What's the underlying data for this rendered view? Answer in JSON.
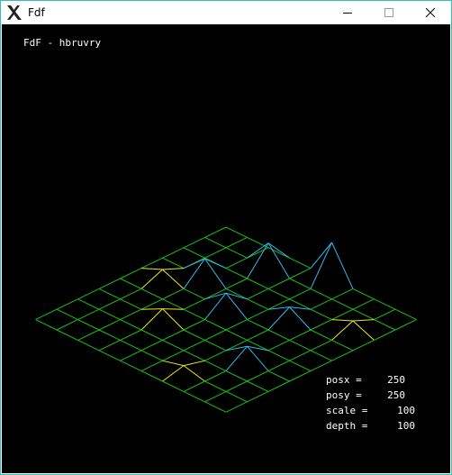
{
  "window": {
    "title": "Fdf",
    "icon": "x-logo-icon",
    "border_color": "#2fc3b0"
  },
  "controls": {
    "minimize_icon": "minimize-icon",
    "maximize_icon": "maximize-icon",
    "close_icon": "close-icon"
  },
  "canvas": {
    "background": "#000000",
    "heading": "FdF - hbruvry",
    "wire_colors": {
      "low": "#18c018",
      "mid": "#e8e820",
      "high": "#30b8f0"
    }
  },
  "hud": [
    {
      "key": "posx =",
      "value": "250"
    },
    {
      "key": "posy =",
      "value": "250"
    },
    {
      "key": "scale =",
      "value": "100"
    },
    {
      "key": "depth =",
      "value": "100"
    }
  ]
}
